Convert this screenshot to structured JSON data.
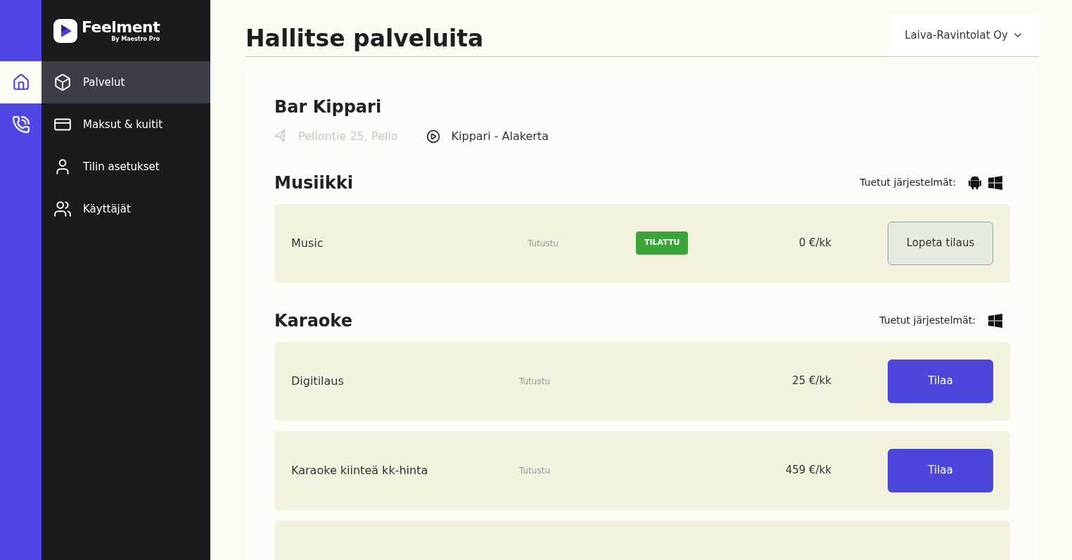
{
  "rail": {
    "items": [
      {
        "selected": true
      },
      {
        "selected": false
      }
    ]
  },
  "brand": {
    "name": "Feelment",
    "tagline": "By Maestro Pro"
  },
  "nav": {
    "items": [
      {
        "label": "Palvelut",
        "selected": true
      },
      {
        "label": "Maksut & kuitit",
        "selected": false
      },
      {
        "label": "Tilin asetukset",
        "selected": false
      },
      {
        "label": "Käyttäjät",
        "selected": false
      }
    ]
  },
  "header": {
    "title": "Hallitse palveluita",
    "company": "Laiva-Ravintolat Oy"
  },
  "venue": {
    "name": "Bar Kippari",
    "address": "Pellontie 25, Pello",
    "player": "Kippari - Alakerta"
  },
  "sections": [
    {
      "title": "Musiikki",
      "platforms_label": "Tuetut järjestelmät:",
      "platforms": [
        {
          "kind": "android"
        },
        {
          "kind": "windows"
        }
      ],
      "services": [
        {
          "name": "Music",
          "link": "Tutustu",
          "badge": "TILATTU",
          "price": "0 €/kk",
          "action": "Lopeta tilaus",
          "kind": "cancel"
        }
      ]
    },
    {
      "title": "Karaoke",
      "platforms_label": "Tuetut järjestelmät:",
      "platforms": [
        {
          "kind": "windows"
        }
      ],
      "services": [
        {
          "name": "Digitilaus",
          "link": "Tutustu",
          "price": "25 €/kk",
          "action": "Tilaa",
          "kind": "order"
        },
        {
          "name": "Karaoke kiinteä kk-hinta",
          "link": "Tutustu",
          "price": "459 €/kk",
          "action": "Tilaa",
          "kind": "order"
        }
      ]
    }
  ]
}
